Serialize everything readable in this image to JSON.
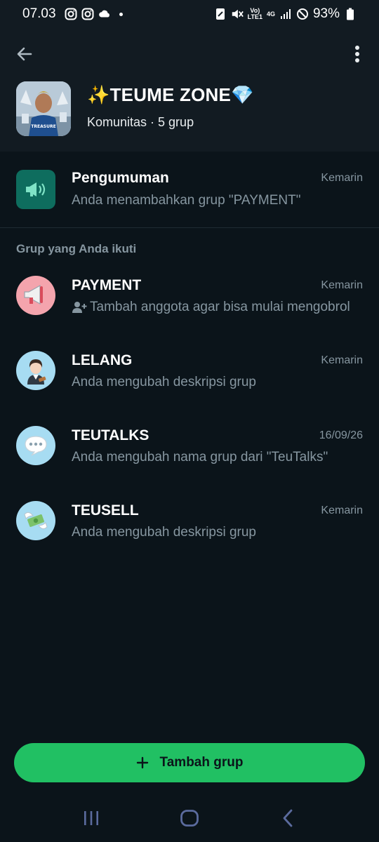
{
  "status_bar": {
    "time": "07.03",
    "battery": "93%",
    "network_top": "Vo)",
    "network_bottom": "LTE1",
    "network_type": "4G",
    "icons": [
      "instagram-icon",
      "instagram-icon",
      "weather-icon",
      "dot-icon",
      "nfc-icon",
      "mute-icon",
      "signal-icon",
      "dnd-icon",
      "battery-icon"
    ]
  },
  "header": {
    "title": "✨TEUME ZONE💎",
    "subtitle": "Komunitas · 5 grup"
  },
  "announcement": {
    "title": "Pengumuman",
    "time": "Kemarin",
    "message": "Anda menambahkan grup \"PAYMENT\""
  },
  "section_label": "Grup yang Anda ikuti",
  "groups": [
    {
      "name": "PAYMENT",
      "time": "Kemarin",
      "message": "Tambah anggota agar bisa mulai mengobrol",
      "avatar_emoji": "📢",
      "avatar_color": "#f4a4ad"
    },
    {
      "name": "LELANG",
      "time": "Kemarin",
      "message": "Anda mengubah deskripsi grup",
      "avatar_emoji": "👩🏻‍⚖️",
      "avatar_color": "#a7dcf2"
    },
    {
      "name": "TEUTALKS",
      "time": "16/09/26",
      "message": "Anda mengubah nama grup dari \"TeuTalks\"",
      "avatar_emoji": "💬",
      "avatar_color": "#a7dcf2"
    },
    {
      "name": "TEUSELL",
      "time": "Kemarin",
      "message": "Anda mengubah deskripsi grup",
      "avatar_emoji": "💸",
      "avatar_color": "#a7dcf2"
    }
  ],
  "add_group_button": {
    "label": "Tambah grup",
    "icon": "plus-icon",
    "color": "#21c063"
  },
  "theme": {
    "background": "#0b141a",
    "header_background": "#121b22",
    "accent": "#21c063",
    "announcement_icon_bg": "#0e6d5e",
    "muted_text": "#8696a0"
  }
}
